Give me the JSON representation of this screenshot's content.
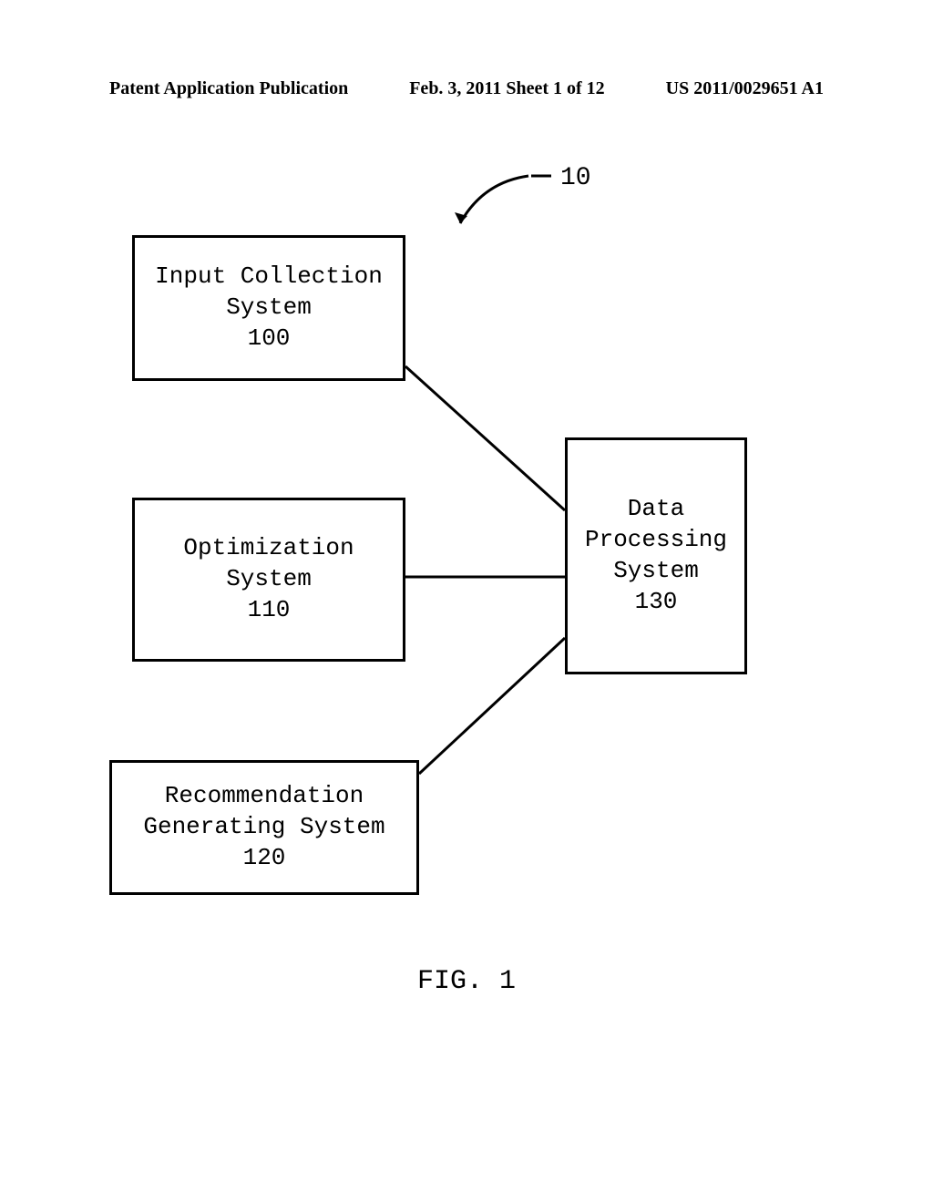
{
  "header": {
    "left": "Patent Application Publication",
    "center": "Feb. 3, 2011  Sheet 1 of 12",
    "right": "US 2011/0029651 A1"
  },
  "reference": {
    "main": "10"
  },
  "boxes": {
    "b100": {
      "line1": "Input Collection",
      "line2": "System",
      "line3": "100"
    },
    "b110": {
      "line1": "Optimization",
      "line2": "System",
      "line3": "110"
    },
    "b120": {
      "line1": "Recommendation",
      "line2": "Generating System",
      "line3": "120"
    },
    "b130": {
      "line1": "Data",
      "line2": "Processing",
      "line3": "System",
      "line4": "130"
    }
  },
  "figure": {
    "caption": "FIG. 1"
  }
}
